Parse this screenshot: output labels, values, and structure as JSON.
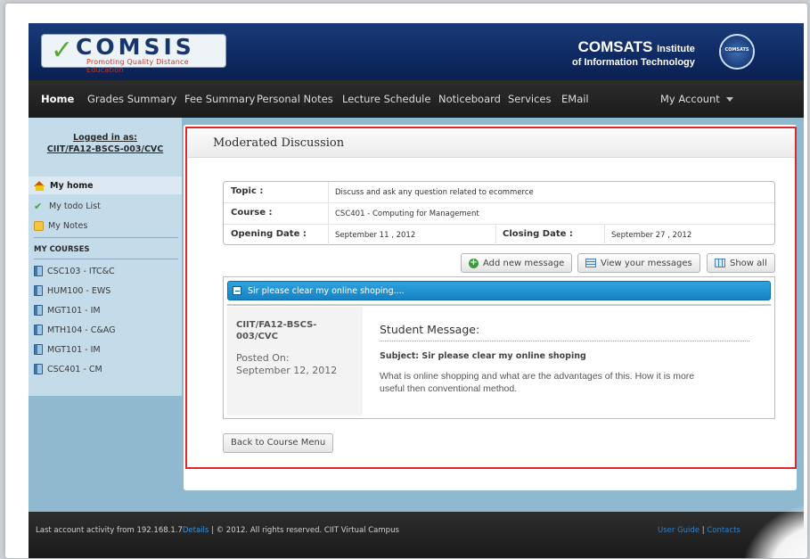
{
  "header": {
    "logo_text": "COMSIS",
    "logo_tagline": "Promoting Quality Distance Education",
    "institute_line1": "COMSATS",
    "institute_line1_small": "Institute",
    "institute_line2": "of Information Technology",
    "seal_text": "COMSATS"
  },
  "nav": {
    "items": [
      "Home",
      "Grades Summary",
      "Fee Summary",
      "Personal Notes",
      "Lecture Schedule",
      "Noticeboard",
      "Services",
      "EMail"
    ],
    "account": "My Account"
  },
  "sidebar": {
    "logged_in_label": "Logged in as:",
    "user_id": "CIIT/FA12-BSCS-003/CVC",
    "links": [
      "My home",
      "My todo List",
      "My Notes"
    ],
    "courses_heading": "MY COURSES",
    "courses": [
      "CSC103 - ITC&C",
      "HUM100 - EWS",
      "MGT101 - IM",
      "MTH104 - C&AG",
      "MGT101 - IM",
      "CSC401 - CM"
    ]
  },
  "page": {
    "title": "Moderated Discussion"
  },
  "info": {
    "topic_label": "Topic :",
    "topic_value": "Discuss and ask any question related to ecommerce",
    "course_label": "Course :",
    "course_value": "CSC401 - Computing for Management",
    "opening_label": "Opening Date :",
    "opening_value": "September 11 , 2012",
    "closing_label": "Closing Date :",
    "closing_value": "September 27 , 2012"
  },
  "actions": {
    "add": "Add new message",
    "view": "View your messages",
    "show_all": "Show all"
  },
  "thread": {
    "title": "Sir please clear my online shoping....",
    "author": "CIIT/FA12-BSCS-003/CVC",
    "posted_label": "Posted On:",
    "posted_date": "September 12, 2012",
    "message_heading": "Student Message:",
    "subject": "Subject: Sir please clear my online shoping",
    "body": "What is online shopping and what are the advantages of this. How it is more useful then conventional method."
  },
  "back_button": "Back to Course Menu",
  "footer": {
    "left_text": "Last account activity from 192.168.1.7",
    "details_link": "Details",
    "copyright": " | © 2012. All rights reserved. CIIT Virtual Campus",
    "user_guide": "User Guide",
    "separator": "|",
    "contacts": "Contacts"
  },
  "colors": {
    "accent_red_box": "#e1272d",
    "nav_bg": "#1f1f1f",
    "sidebar_bg": "#c4dbea",
    "page_bg": "#8fb9ce",
    "thread_header": "#1a8fd0"
  }
}
